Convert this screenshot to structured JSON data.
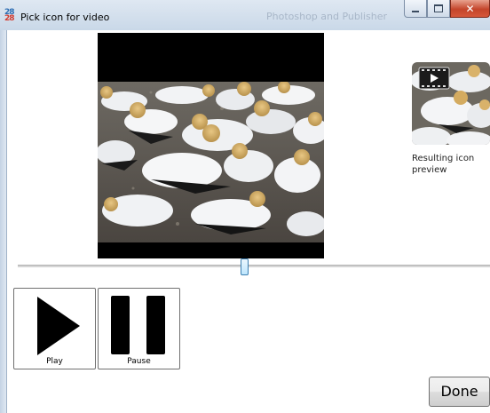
{
  "window": {
    "title": "Pick icon for video",
    "icon": "app-icon-28",
    "icon_text_top": "28",
    "icon_text_bottom": "28",
    "background_title": "Photoshop and Publisher"
  },
  "titlebar_buttons": {
    "minimize_icon": "minimize-icon",
    "maximize_icon": "maximize-icon",
    "close_icon": "close-icon",
    "close_glyph": "✕"
  },
  "video": {
    "content": "video-frame-birds"
  },
  "preview": {
    "label": "Resulting icon preview",
    "overlay_icon": "film-play-icon"
  },
  "slider": {
    "position": 0.48
  },
  "controls": {
    "play_label": "Play",
    "pause_label": "Pause"
  },
  "done_label": "Done",
  "colors": {
    "close_button": "#c4452b",
    "thumb_border": "#3c7fb1",
    "title_bar": "#dfe8f2"
  }
}
